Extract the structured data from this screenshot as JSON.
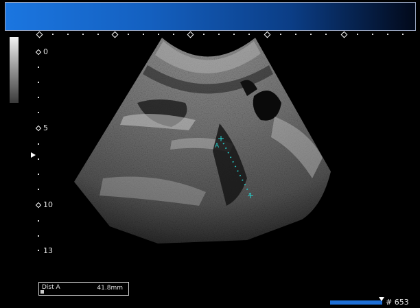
{
  "depth_scale": {
    "labels": [
      "0",
      "5",
      "10",
      "13"
    ]
  },
  "measurement": {
    "label": "Dist A",
    "value": "41.8mm"
  },
  "frame": {
    "number": "# 653"
  },
  "caliper": {
    "marker": "A",
    "color": "#27d3d0"
  },
  "colors": {
    "header_bar": "#1b76e0",
    "frame_bar": "#1e6fd6"
  }
}
